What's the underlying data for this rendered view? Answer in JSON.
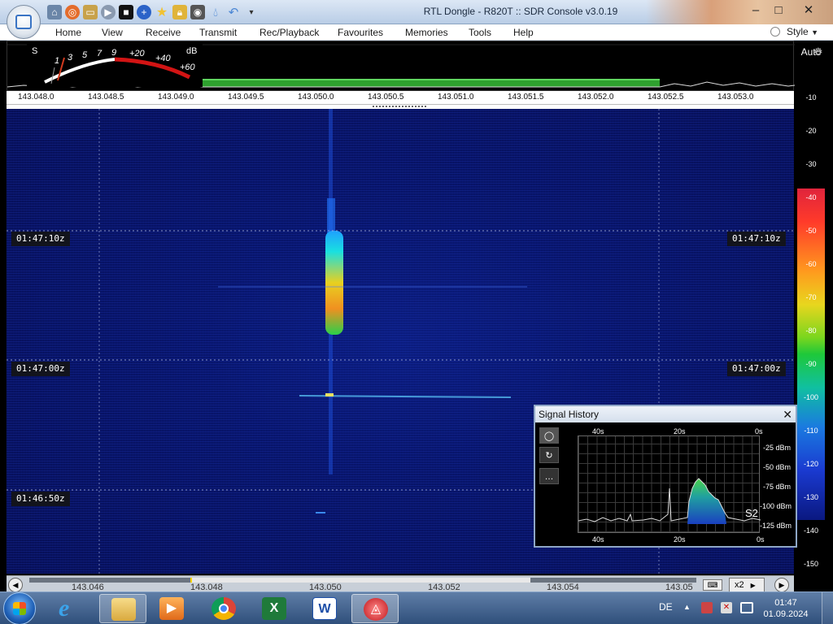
{
  "window": {
    "title": "RTL Dongle - R820T :: SDR Console v3.0.19",
    "controls": [
      "minimize",
      "maximize",
      "close"
    ],
    "quick_access": [
      "home-icon",
      "lifebuoy-icon",
      "folder-icon",
      "play-icon",
      "stop-icon",
      "plus-icon",
      "star-icon",
      "lock-icon",
      "camera-icon",
      "drop-icon",
      "undo-icon",
      "dropdown-icon"
    ]
  },
  "menu": {
    "items": [
      "Home",
      "View",
      "Receive",
      "Transmit",
      "Rec/Playback",
      "Favourites",
      "Memories",
      "Tools",
      "Help"
    ],
    "style_label": "Style"
  },
  "smeter": {
    "s_label": "S",
    "scale_labels": [
      "1",
      "3",
      "5",
      "7",
      "9",
      "+20",
      "+40",
      "+60"
    ],
    "db_label": "dB"
  },
  "spectrum": {
    "auto_label": "Auto",
    "frequencies": [
      "143.048.0",
      "143.048.5",
      "143.049.0",
      "143.049.5",
      "143.050.0",
      "143.050.5",
      "143.051.0",
      "143.051.5",
      "143.052.0",
      "143.052.5",
      "143.053.0"
    ]
  },
  "colorscale": {
    "labels": [
      "-10",
      "-20",
      "-30",
      "-40",
      "-50",
      "-60",
      "-70",
      "-80",
      "-90",
      "-100",
      "-110",
      "-120",
      "-130",
      "-140",
      "-150"
    ]
  },
  "waterfall": {
    "time_markers": [
      "01:47:10z",
      "01:47:00z",
      "01:46:50z"
    ]
  },
  "bottom_band": {
    "frequencies": [
      "143.046",
      "143.048",
      "143.050",
      "143.052",
      "143.054",
      "143.05"
    ],
    "zoom": "x2"
  },
  "signal_history": {
    "title": "Signal History",
    "time_top": [
      "40s",
      "20s",
      "0s"
    ],
    "time_bottom": [
      "40s",
      "20s",
      "0s"
    ],
    "dbm_labels": [
      "-25 dBm",
      "-50 dBm",
      "-75 dBm",
      "-100 dBm",
      "-125 dBm"
    ],
    "s_reading": "S2"
  },
  "taskbar": {
    "apps": [
      "internet-explorer",
      "file-explorer",
      "media-player",
      "chrome",
      "excel",
      "word",
      "sdr-console"
    ],
    "language": "DE",
    "time": "01:47",
    "date": "01.09.2024"
  }
}
